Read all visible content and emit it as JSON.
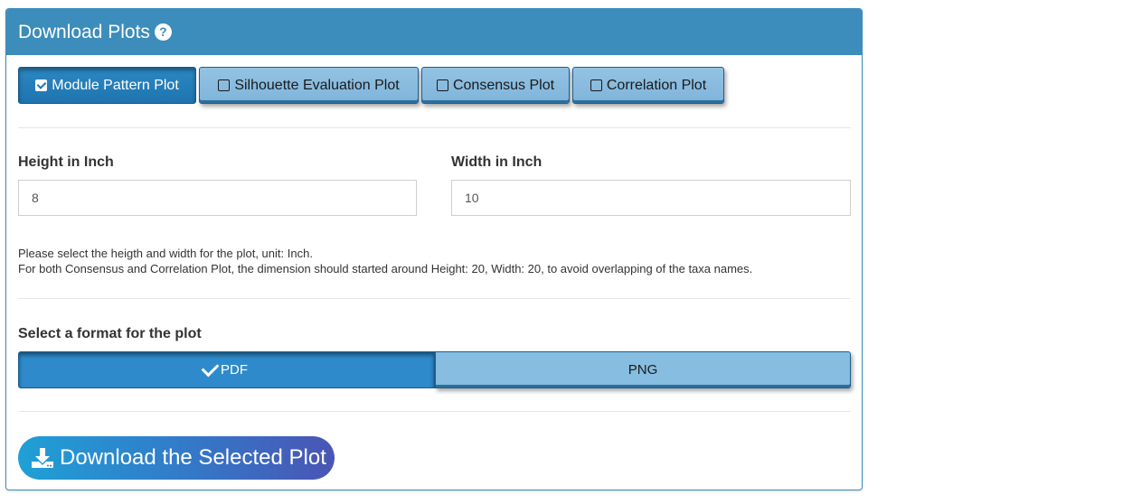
{
  "panel": {
    "title": "Download Plots",
    "help_icon": "question-circle-icon"
  },
  "tabs": [
    {
      "label": "Module Pattern Plot",
      "checked": true
    },
    {
      "label": "Silhouette Evaluation Plot",
      "checked": false
    },
    {
      "label": "Consensus Plot",
      "checked": false
    },
    {
      "label": "Correlation Plot",
      "checked": false
    }
  ],
  "height": {
    "label": "Height in Inch",
    "value": "8"
  },
  "width": {
    "label": "Width in Inch",
    "value": "10"
  },
  "help": {
    "line1": "Please select the heigth and width for the plot, unit: Inch.",
    "line2": "For both Consensus and Correlation Plot, the dimension should started around Height: 20, Width: 20, to avoid overlapping of the taxa names."
  },
  "format": {
    "label": "Select a format for the plot",
    "options": [
      "PDF",
      "PNG"
    ],
    "selected": "PDF"
  },
  "download": {
    "label": "Download the Selected Plot",
    "icon": "download-icon"
  },
  "colors": {
    "header": "#3c8dbc",
    "active_button": "#2e8acb",
    "inactive_button": "#86bde0"
  }
}
